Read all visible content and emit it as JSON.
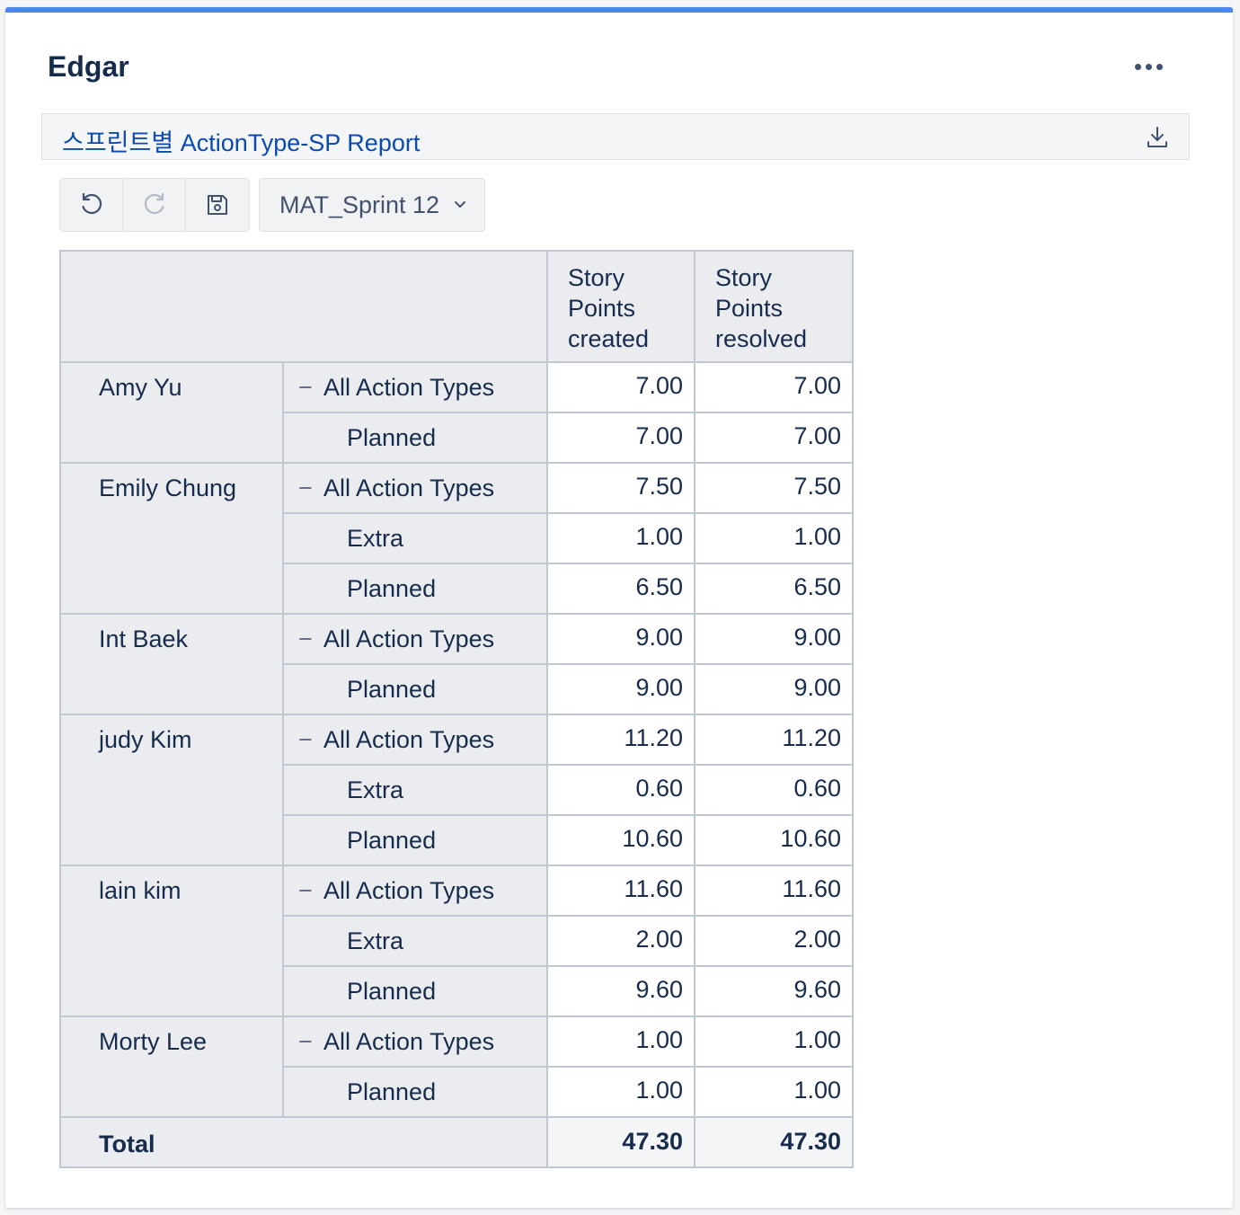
{
  "gadget": {
    "title": "Edgar",
    "menu_icon": "more-horizontal-icon"
  },
  "report": {
    "title": "스프린트별 ActionType-SP Report",
    "download_icon": "download-icon"
  },
  "toolbar": {
    "undo_icon": "undo-icon",
    "redo_icon": "redo-icon",
    "save_icon": "save-icon",
    "sprint_value": "MAT_Sprint 12"
  },
  "table": {
    "columns": [
      "Story\nPoints\ncreated",
      "Story\nPoints\nresolved"
    ],
    "collapse_symbol": "−",
    "groups": [
      {
        "name": "Amy Yu",
        "rows": [
          {
            "type": "All Action Types",
            "all": true,
            "created": "7.00",
            "resolved": "7.00"
          },
          {
            "type": "Planned",
            "created": "7.00",
            "resolved": "7.00"
          }
        ]
      },
      {
        "name": "Emily Chung",
        "rows": [
          {
            "type": "All Action Types",
            "all": true,
            "created": "7.50",
            "resolved": "7.50"
          },
          {
            "type": "Extra",
            "created": "1.00",
            "resolved": "1.00"
          },
          {
            "type": "Planned",
            "created": "6.50",
            "resolved": "6.50"
          }
        ]
      },
      {
        "name": "Int Baek",
        "rows": [
          {
            "type": "All Action Types",
            "all": true,
            "created": "9.00",
            "resolved": "9.00"
          },
          {
            "type": "Planned",
            "created": "9.00",
            "resolved": "9.00"
          }
        ]
      },
      {
        "name": "judy Kim",
        "rows": [
          {
            "type": "All Action Types",
            "all": true,
            "created": "11.20",
            "resolved": "11.20"
          },
          {
            "type": "Extra",
            "created": "0.60",
            "resolved": "0.60"
          },
          {
            "type": "Planned",
            "created": "10.60",
            "resolved": "10.60"
          }
        ]
      },
      {
        "name": "lain kim",
        "rows": [
          {
            "type": "All Action Types",
            "all": true,
            "created": "11.60",
            "resolved": "11.60"
          },
          {
            "type": "Extra",
            "created": "2.00",
            "resolved": "2.00"
          },
          {
            "type": "Planned",
            "created": "9.60",
            "resolved": "9.60"
          }
        ]
      },
      {
        "name": "Morty Lee",
        "rows": [
          {
            "type": "All Action Types",
            "all": true,
            "created": "1.00",
            "resolved": "1.00"
          },
          {
            "type": "Planned",
            "created": "1.00",
            "resolved": "1.00"
          }
        ]
      }
    ],
    "total": {
      "label": "Total",
      "created": "47.30",
      "resolved": "47.30"
    }
  }
}
